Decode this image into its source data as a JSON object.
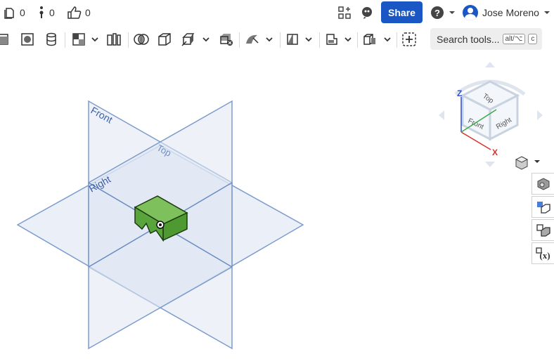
{
  "stats": {
    "versions": "0",
    "branches": "0",
    "likes": "0"
  },
  "header": {
    "share_label": "Share",
    "user_name": "Jose Moreno"
  },
  "search": {
    "label": "Search tools...",
    "shortcut_1": "alt/⌥",
    "shortcut_2": "c"
  },
  "planes": {
    "front": "Front",
    "top": "Top",
    "right": "Right"
  },
  "viewcube": {
    "top": "Top",
    "front": "Front",
    "right": "Right",
    "z_axis": "Z",
    "x_axis": "X"
  },
  "colors": {
    "accent": "#1a57c4",
    "plane_fill": "#dde6f2",
    "plane_stroke": "#7c9ccc",
    "part_green": "#5aa43c",
    "axis_x": "#d9302c",
    "axis_y": "#3aa84a",
    "axis_z": "#2e4fd6"
  },
  "icons": [
    "versions-icon",
    "branches-icon",
    "like-icon",
    "app-store-icon",
    "learning-icon",
    "help-icon",
    "extrude-icon",
    "revolve-icon",
    "sweep-icon",
    "boolean-icon",
    "fillet-icon",
    "shell-icon",
    "plane-icon",
    "sketch-icon",
    "mate-icon",
    "add-icon",
    "view-cube-icon",
    "render-icon",
    "configurations-icon",
    "mass-icon",
    "variables-icon"
  ]
}
